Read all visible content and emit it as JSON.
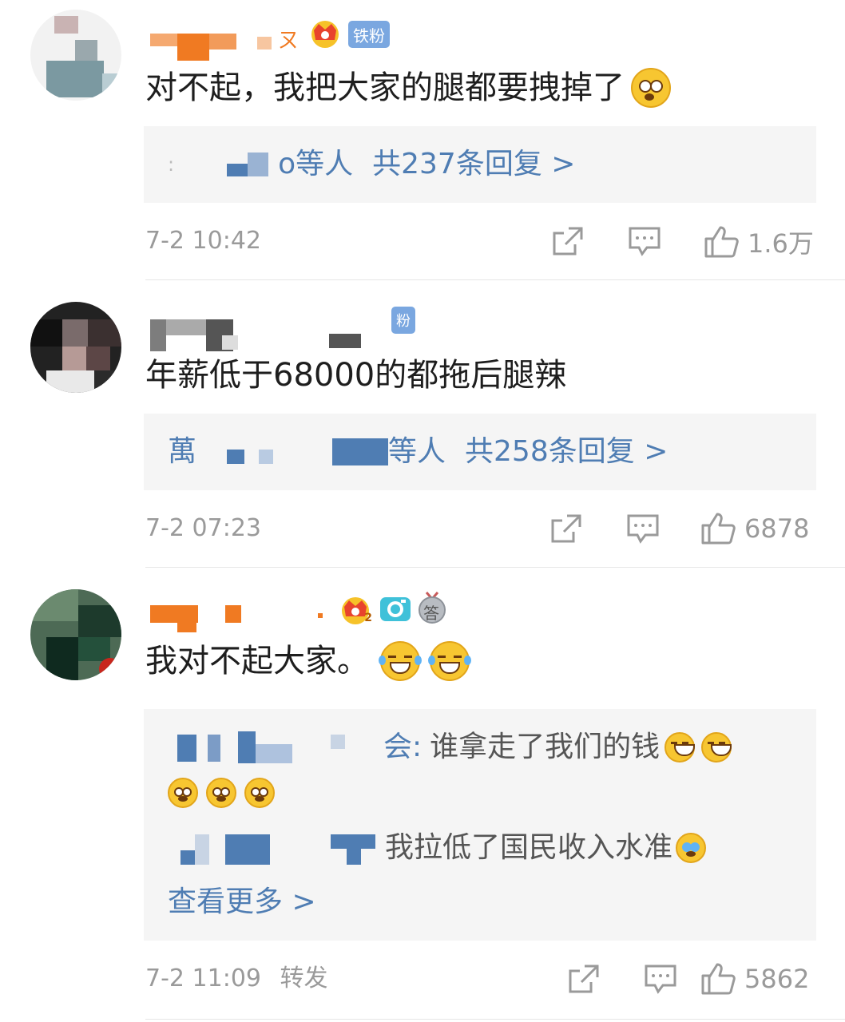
{
  "comments": [
    {
      "badges": {
        "fan": "铁粉"
      },
      "text": "对不起，我把大家的腿都要拽掉了",
      "reply_summary": {
        "suffix": "o等人",
        "link": "共237条回复 >"
      },
      "time": "7-2 10:42",
      "likes": "1.6万"
    },
    {
      "badges": {
        "fan": "粉"
      },
      "text": "年薪低于68000的都拖后腿辣",
      "reply_summary": {
        "prefix": "萬",
        "suffix": "等人",
        "link": "共258条回复 >"
      },
      "time": "7-2 07:23",
      "likes": "6878"
    },
    {
      "badges": {
        "crown_level": "2",
        "answer": "答"
      },
      "text": "我对不起大家。",
      "replies": [
        {
          "author_suffix": "会:",
          "text": "谁拿走了我们的钱"
        },
        {
          "text": "我拉低了国民收入水准"
        }
      ],
      "more_link": "查看更多 >",
      "time": "7-2 11:09",
      "repost": "转发",
      "likes": "5862"
    }
  ],
  "colors": {
    "link": "#4f7db3",
    "meta": "#9a9a9a",
    "reply_bg": "#f5f5f5",
    "badge_fan": "#7aa7e0",
    "censor_orange": "#f07a22",
    "censor_blue": "#4f7db3"
  },
  "icons": [
    "crown-icon",
    "share-icon",
    "comment-icon",
    "like-icon",
    "camera-badge-icon",
    "answer-badge-icon"
  ]
}
